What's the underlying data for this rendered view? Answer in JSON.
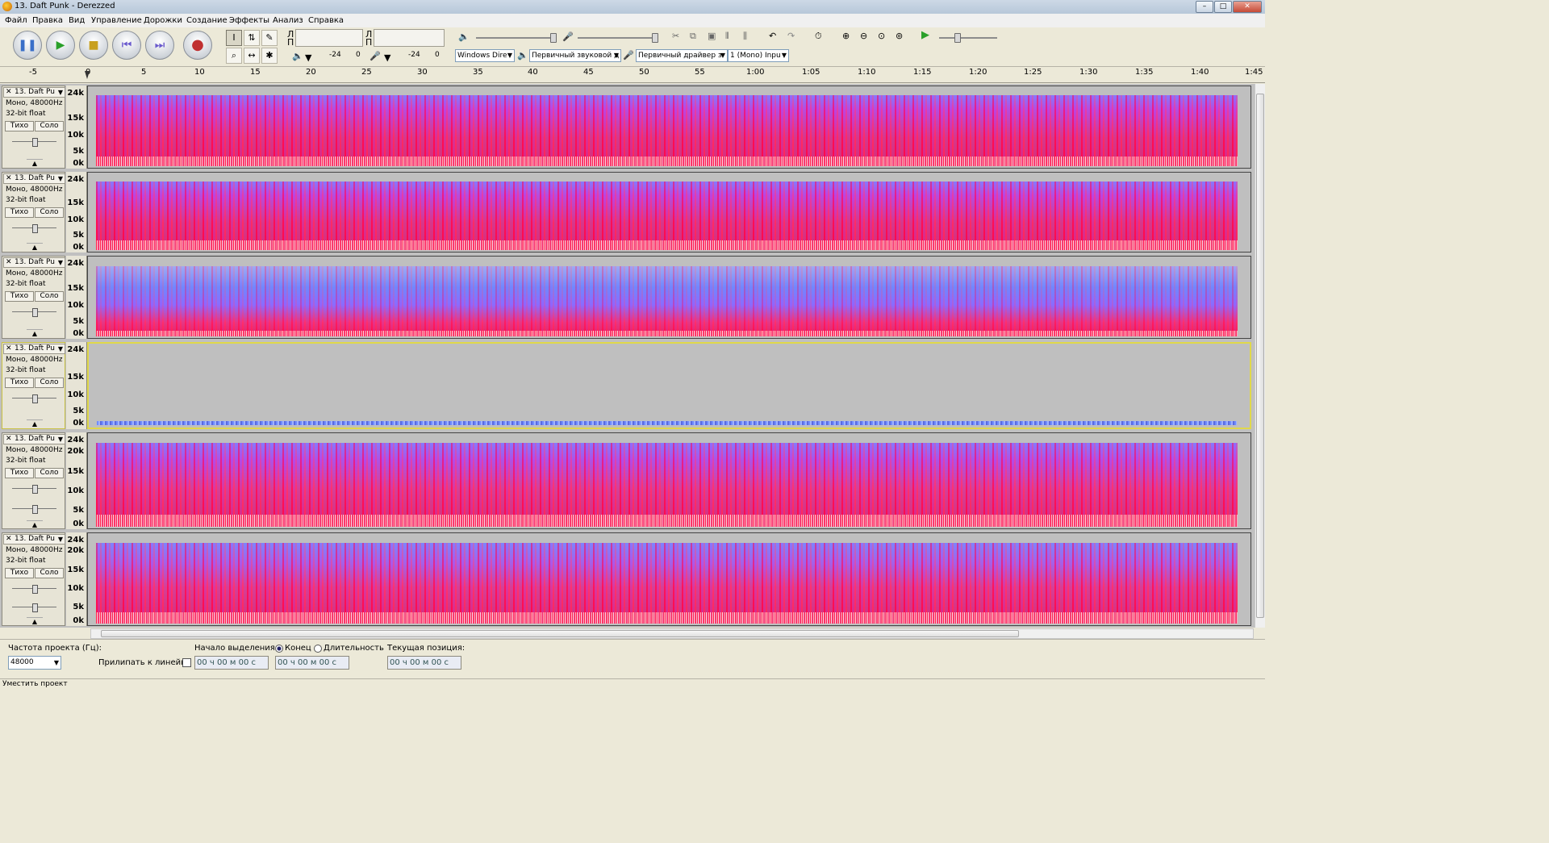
{
  "window": {
    "title": "13. Daft Punk - Derezzed",
    "minimize": "–",
    "maximize": "□",
    "close": "✕"
  },
  "menu": {
    "items": [
      "Файл",
      "Правка",
      "Вид",
      "Управление",
      "Дорожки",
      "Создание",
      "Эффекты",
      "Анализ",
      "Справка"
    ]
  },
  "transport": {
    "pause": "❚❚",
    "play": "▶",
    "stop": "■",
    "skip_start": "⏮",
    "skip_end": "⏭",
    "record": "●"
  },
  "tools": {
    "select": "I",
    "envelope": "⇅",
    "draw": "✎",
    "zoom": "⌕",
    "timeshift": "↔",
    "multi": "✱"
  },
  "meters": {
    "l_top": "Л",
    "p_top": "П",
    "l_bottom": "Л",
    "p_bottom": "П",
    "scale_a": "-24",
    "scale_a0": "0",
    "scale_b": "-24",
    "scale_b0": "0"
  },
  "devices": {
    "host": "Windows Dire",
    "playback": "Первичный звуковой д",
    "recording": "Первичный драйвер з",
    "channels": "1 (Mono) Inpu"
  },
  "ruler": {
    "ticks": [
      "-5",
      "0",
      "5",
      "10",
      "15",
      "20",
      "25",
      "30",
      "35",
      "40",
      "45",
      "50",
      "55",
      "1:00",
      "1:05",
      "1:10",
      "1:15",
      "1:20",
      "1:25",
      "1:30",
      "1:35",
      "1:40",
      "1:45"
    ]
  },
  "tracks": [
    {
      "name": "13. Daft Pu",
      "format": "Моно, 48000Hz",
      "depth": "32-bit float",
      "mute": "Тихо",
      "solo": "Соло",
      "scale": [
        "24k",
        "15k",
        "10k",
        "5k",
        "0k"
      ]
    },
    {
      "name": "13. Daft Pu",
      "format": "Моно, 48000Hz",
      "depth": "32-bit float",
      "mute": "Тихо",
      "solo": "Соло",
      "scale": [
        "24k",
        "15k",
        "10k",
        "5k",
        "0k"
      ]
    },
    {
      "name": "13. Daft Pu",
      "format": "Моно, 48000Hz",
      "depth": "32-bit float",
      "mute": "Тихо",
      "solo": "Соло",
      "scale": [
        "24k",
        "15k",
        "10k",
        "5k",
        "0k"
      ]
    },
    {
      "name": "13. Daft Pu",
      "format": "Моно, 48000Hz",
      "depth": "32-bit float",
      "mute": "Тихо",
      "solo": "Соло",
      "scale": [
        "24k",
        "15k",
        "10k",
        "5k",
        "0k"
      ]
    },
    {
      "name": "13. Daft Pu",
      "format": "Моно, 48000Hz",
      "depth": "32-bit float",
      "mute": "Тихо",
      "solo": "Соло",
      "scale": [
        "24k",
        "20k",
        "15k",
        "10k",
        "5k",
        "0k"
      ]
    },
    {
      "name": "13. Daft Pu",
      "format": "Моно, 48000Hz",
      "depth": "32-bit float",
      "mute": "Тихо",
      "solo": "Соло",
      "scale": [
        "24k",
        "20k",
        "15k",
        "10k",
        "5k",
        "0k"
      ]
    }
  ],
  "selection_bar": {
    "rate_label": "Частота проекта (Гц):",
    "rate_value": "48000",
    "snap_label": "Прилипать к линейке",
    "start_label": "Начало выделения:",
    "end_option": "Конец",
    "length_option": "Длительность",
    "position_label": "Текущая позиция:",
    "start_time": "00 ч 00 м 00 с",
    "end_time": "00 ч 00 м 00 с",
    "position_time": "00 ч 00 м 00 с"
  },
  "status": {
    "text": "Уместить проект"
  },
  "colors": {
    "spectrum_hot": "#ff1040",
    "spectrum_cool": "#6a80ff",
    "selected_border": "#e0d84a"
  }
}
